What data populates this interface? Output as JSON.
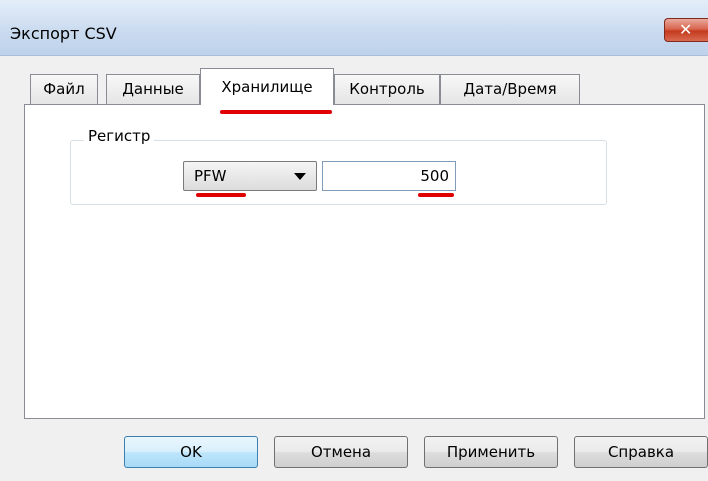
{
  "window": {
    "title": "Экспорт CSV",
    "close_symbol": "✕"
  },
  "tabs": [
    {
      "label": "Файл",
      "active": false
    },
    {
      "label": "Данные",
      "active": false
    },
    {
      "label": "Хранилище",
      "active": true
    },
    {
      "label": "Контроль",
      "active": false
    },
    {
      "label": "Дата/Время",
      "active": false
    }
  ],
  "register_group": {
    "label": "Регистр",
    "type_select": {
      "value": "PFW",
      "icon": "chevron-down-icon"
    },
    "address_input": {
      "value": "500"
    }
  },
  "buttons": {
    "ok": "OK",
    "cancel": "Отмена",
    "apply": "Применить",
    "help": "Справка"
  },
  "colors": {
    "highlight_underline": "#e00000",
    "default_button": "#bee6fd"
  }
}
